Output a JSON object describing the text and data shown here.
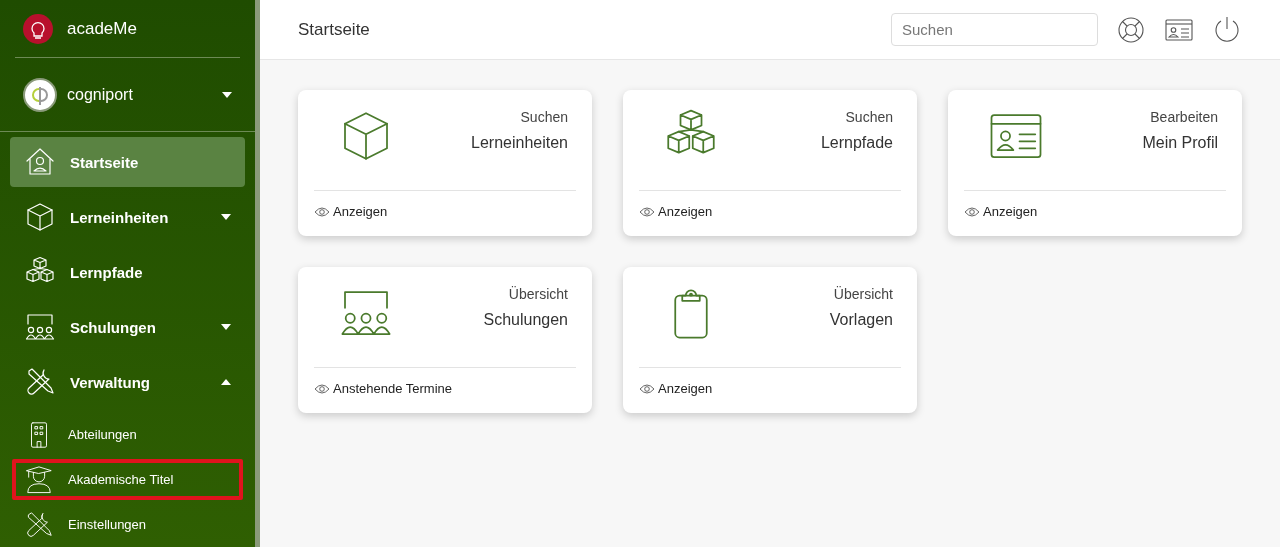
{
  "brand": {
    "name": "acadeMe"
  },
  "account": {
    "name": "cogniport",
    "expanded": false
  },
  "nav": [
    {
      "label": "Startseite",
      "selected": true
    },
    {
      "label": "Lerneinheiten",
      "selected": false,
      "expanded": false
    },
    {
      "label": "Lernpfade",
      "selected": false
    },
    {
      "label": "Schulungen",
      "selected": false,
      "expanded": false
    },
    {
      "label": "Verwaltung",
      "selected": false,
      "expanded": true,
      "children": [
        {
          "label": "Abteilungen",
          "selected": false,
          "annotated": false
        },
        {
          "label": "Akademische Titel",
          "selected": false,
          "annotated": true
        },
        {
          "label": "Einstellungen",
          "selected": false,
          "annotated": false
        }
      ]
    }
  ],
  "header": {
    "title": "Startseite",
    "search": {
      "placeholder": "Suchen"
    }
  },
  "cards": [
    {
      "caption": "Suchen",
      "title": "Lerneinheiten",
      "link": "Anzeigen"
    },
    {
      "caption": "Suchen",
      "title": "Lernpfade",
      "link": "Anzeigen"
    },
    {
      "caption": "Bearbeiten",
      "title": "Mein Profil",
      "link": "Anzeigen"
    },
    {
      "caption": "Übersicht",
      "title": "Schulungen",
      "link": "Anstehende Termine"
    },
    {
      "caption": "Übersicht",
      "title": "Vorlagen",
      "link": "Anzeigen"
    }
  ]
}
